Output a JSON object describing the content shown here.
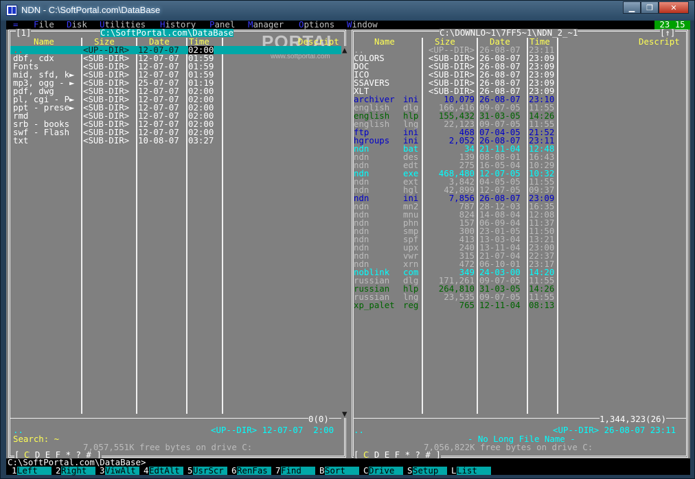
{
  "window": {
    "title": "NDN - C:\\SoftPortal.com\\DataBase"
  },
  "menu": {
    "clock": "23 15",
    "items": [
      {
        "pre": "",
        "hk": "=",
        "rest": ""
      },
      {
        "pre": "",
        "hk": "F",
        "rest": "ile"
      },
      {
        "pre": "",
        "hk": "D",
        "rest": "isk"
      },
      {
        "pre": "",
        "hk": "U",
        "rest": "tilities"
      },
      {
        "pre": "",
        "hk": "H",
        "rest": "istory"
      },
      {
        "pre": "",
        "hk": "P",
        "rest": "anel"
      },
      {
        "pre": "",
        "hk": "M",
        "rest": "anager"
      },
      {
        "pre": "",
        "hk": "O",
        "rest": "ptions"
      },
      {
        "pre": "",
        "hk": "W",
        "rest": "indow"
      }
    ]
  },
  "watermark": {
    "logo": "PORTAL",
    "site": "www.softportal.com"
  },
  "left": {
    "number": "[1]",
    "path": "C:\\SoftPortal.com\\DataBase",
    "headers": {
      "name": "Name",
      "size": "Size",
      "date": "Date",
      "time": "Time",
      "descr": "Descript"
    },
    "rows": [
      {
        "name": "..",
        "size": "<UP--DIR>",
        "date": "12-07-07",
        "time": "02:00"
      },
      {
        "name": "dbf, cdx",
        "size": "<SUB-DIR>",
        "date": "12-07-07",
        "time": "01:59"
      },
      {
        "name": "Fonts",
        "size": "<SUB-DIR>",
        "date": "12-07-07",
        "time": "01:59"
      },
      {
        "name": "mid, sfd, k►",
        "size": "<SUB-DIR>",
        "date": "12-07-07",
        "time": "01:59"
      },
      {
        "name": "mp3, ogg - ►",
        "size": "<SUB-DIR>",
        "date": "25-07-07",
        "time": "01:19"
      },
      {
        "name": "pdf, dwg",
        "size": "<SUB-DIR>",
        "date": "12-07-07",
        "time": "02:00"
      },
      {
        "name": "pl, cgi - P►",
        "size": "<SUB-DIR>",
        "date": "12-07-07",
        "time": "02:00"
      },
      {
        "name": "ppt - prese►",
        "size": "<SUB-DIR>",
        "date": "12-07-07",
        "time": "02:00"
      },
      {
        "name": "rmd",
        "size": "<SUB-DIR>",
        "date": "12-07-07",
        "time": "02:00"
      },
      {
        "name": "srb - books",
        "size": "<SUB-DIR>",
        "date": "12-07-07",
        "time": "02:00"
      },
      {
        "name": "swf - Flash",
        "size": "<SUB-DIR>",
        "date": "12-07-07",
        "time": "02:00"
      },
      {
        "name": "txt",
        "size": "<SUB-DIR>",
        "date": "10-08-07",
        "time": "03:27"
      }
    ],
    "count": "0(0)",
    "info_name": "..",
    "info_rest": "<UP--DIR> 12-07-07  2:00",
    "search": "Search: ~",
    "free": "7,057,551K free bytes on drive C:",
    "drives": "[ C D E F * ? # ]"
  },
  "right": {
    "number": "[↑]",
    "path": "C:\\DOWNLO~1\\7FF5~1\\NDN_2_~1",
    "headers": {
      "name": "Name",
      "size": "Size",
      "date": "Date",
      "time": "Time",
      "descr": "Descript"
    },
    "rows": [
      {
        "name": "..",
        "ext": "",
        "size": "<UP--DIR>",
        "date": "26-08-07",
        "time": "23:11",
        "color": "l"
      },
      {
        "name": "COLORS",
        "ext": "",
        "size": "<SUB-DIR>",
        "date": "26-08-07",
        "time": "23:09",
        "color": "w"
      },
      {
        "name": "DOC",
        "ext": "",
        "size": "<SUB-DIR>",
        "date": "26-08-07",
        "time": "23:09",
        "color": "w"
      },
      {
        "name": "ICO",
        "ext": "",
        "size": "<SUB-DIR>",
        "date": "26-08-07",
        "time": "23:09",
        "color": "w"
      },
      {
        "name": "SSAVERS",
        "ext": "",
        "size": "<SUB-DIR>",
        "date": "26-08-07",
        "time": "23:09",
        "color": "w"
      },
      {
        "name": "XLT",
        "ext": "",
        "size": "<SUB-DIR>",
        "date": "26-08-07",
        "time": "23:09",
        "color": "w"
      },
      {
        "name": "archiver",
        "ext": "ini",
        "size": "10,079",
        "date": "26-08-07",
        "time": "23:10",
        "color": "b"
      },
      {
        "name": "english",
        "ext": "dlg",
        "size": "166,416",
        "date": "09-07-05",
        "time": "11:55",
        "color": "l"
      },
      {
        "name": "english",
        "ext": "hlp",
        "size": "155,432",
        "date": "31-03-05",
        "time": "14:26",
        "color": "g"
      },
      {
        "name": "english",
        "ext": "lng",
        "size": "22,123",
        "date": "09-07-05",
        "time": "11:55",
        "color": "l"
      },
      {
        "name": "ftp",
        "ext": "ini",
        "size": "468",
        "date": "07-04-05",
        "time": "21:52",
        "color": "b"
      },
      {
        "name": "hgroups",
        "ext": "ini",
        "size": "2,052",
        "date": "26-08-07",
        "time": "23:11",
        "color": "b"
      },
      {
        "name": "ndn",
        "ext": "bat",
        "size": "34",
        "date": "21-11-04",
        "time": "12:48",
        "color": "c"
      },
      {
        "name": "ndn",
        "ext": "des",
        "size": "139",
        "date": "08-08-01",
        "time": "16:43",
        "color": "l"
      },
      {
        "name": "ndn",
        "ext": "edt",
        "size": "275",
        "date": "16-05-04",
        "time": "10:29",
        "color": "l"
      },
      {
        "name": "ndn",
        "ext": "exe",
        "size": "468,480",
        "date": "12-07-05",
        "time": "10:32",
        "color": "c"
      },
      {
        "name": "ndn",
        "ext": "ext",
        "size": "3,842",
        "date": "04-05-05",
        "time": "11:55",
        "color": "l"
      },
      {
        "name": "ndn",
        "ext": "hgl",
        "size": "42,899",
        "date": "12-07-05",
        "time": "09:37",
        "color": "l"
      },
      {
        "name": "ndn",
        "ext": "ini",
        "size": "7,856",
        "date": "26-08-07",
        "time": "23:09",
        "color": "b"
      },
      {
        "name": "ndn",
        "ext": "mn2",
        "size": "787",
        "date": "28-12-03",
        "time": "16:35",
        "color": "l"
      },
      {
        "name": "ndn",
        "ext": "mnu",
        "size": "824",
        "date": "14-08-04",
        "time": "12:08",
        "color": "l"
      },
      {
        "name": "ndn",
        "ext": "phn",
        "size": "157",
        "date": "06-09-04",
        "time": "11:37",
        "color": "l"
      },
      {
        "name": "ndn",
        "ext": "smp",
        "size": "300",
        "date": "23-01-05",
        "time": "11:50",
        "color": "l"
      },
      {
        "name": "ndn",
        "ext": "spf",
        "size": "413",
        "date": "13-03-04",
        "time": "13:21",
        "color": "l"
      },
      {
        "name": "ndn",
        "ext": "upx",
        "size": "240",
        "date": "13-11-04",
        "time": "23:00",
        "color": "l"
      },
      {
        "name": "ndn",
        "ext": "vwr",
        "size": "315",
        "date": "21-07-04",
        "time": "22:37",
        "color": "l"
      },
      {
        "name": "ndn",
        "ext": "xrn",
        "size": "472",
        "date": "06-10-01",
        "time": "23:17",
        "color": "l"
      },
      {
        "name": "noblink",
        "ext": "com",
        "size": "349",
        "date": "24-03-00",
        "time": "14:20",
        "color": "c"
      },
      {
        "name": "russian",
        "ext": "dlg",
        "size": "171,261",
        "date": "09-07-05",
        "time": "11:55",
        "color": "l"
      },
      {
        "name": "russian",
        "ext": "hlp",
        "size": "264,810",
        "date": "31-03-05",
        "time": "14:26",
        "color": "g"
      },
      {
        "name": "russian",
        "ext": "lng",
        "size": "23,535",
        "date": "09-07-05",
        "time": "11:55",
        "color": "l"
      },
      {
        "name": "xp_palet",
        "ext": "reg",
        "size": "765",
        "date": "12-11-04",
        "time": "08:13",
        "color": "g"
      }
    ],
    "count": "1,344,323(26)",
    "info_name": "..",
    "info_rest": "<UP--DIR> 26-08-07 23:11",
    "nolong": "- No Long File Name -",
    "free": "7,056,822K free bytes on drive C:",
    "drives": "[ C D E F * ? # ]"
  },
  "cmdline": "C:\\SoftPortal.com\\DataBase>",
  "fkeys": [
    {
      "key": "1",
      "label": "Left"
    },
    {
      "key": "2",
      "label": "Right"
    },
    {
      "key": "3",
      "label": "ViwAlt"
    },
    {
      "key": "4",
      "label": "EdtAlt"
    },
    {
      "key": "5",
      "label": "UsrScr"
    },
    {
      "key": "6",
      "label": "RenFas"
    },
    {
      "key": "7",
      "label": "Find"
    },
    {
      "key": "B",
      "label": "Sort"
    },
    {
      "key": "C",
      "label": "Drive"
    },
    {
      "key": "S",
      "label": "Setup"
    },
    {
      "key": "L",
      "label": "List"
    }
  ]
}
